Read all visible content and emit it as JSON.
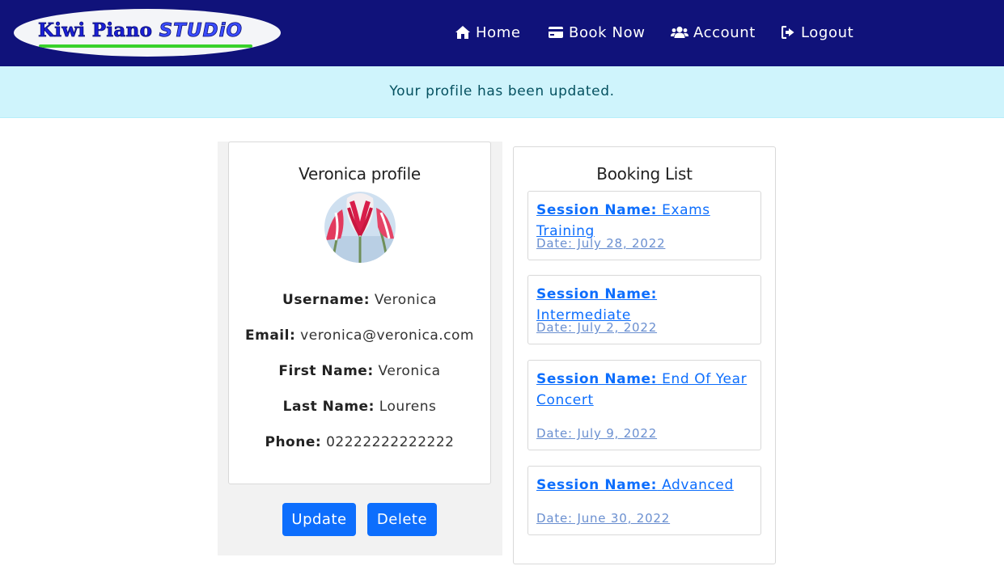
{
  "brand": {
    "logo_text": "Kiwi Piano",
    "logo_text_studio": "STUDiO"
  },
  "nav": {
    "home": "Home",
    "book_now": "Book Now",
    "account": "Account",
    "logout": "Logout"
  },
  "alert": {
    "message": "Your profile has been updated."
  },
  "profile": {
    "title": "Veronica profile",
    "fields": [
      {
        "label": "Username:",
        "value": "Veronica"
      },
      {
        "label": "Email:",
        "value": "veronica@veronica.com"
      },
      {
        "label": "First Name:",
        "value": "Veronica"
      },
      {
        "label": "Last Name:",
        "value": "Lourens"
      },
      {
        "label": "Phone:",
        "value": "02222222222222"
      }
    ],
    "update_label": "Update",
    "delete_label": "Delete"
  },
  "bookings": {
    "title": "Booking List",
    "items": [
      {
        "session_label": "Session Name:",
        "session_name": "Exams Training",
        "date": "Date: July 28, 2022"
      },
      {
        "session_label": "Session Name:",
        "session_name": "Intermediate",
        "date": "Date: July 2, 2022"
      },
      {
        "session_label": "Session Name:",
        "session_name": "End Of Year Concert",
        "date": "Date: July 9, 2022"
      },
      {
        "session_label": "Session Name:",
        "session_name": "Advanced",
        "date": "Date: June 30, 2022"
      }
    ]
  },
  "colors": {
    "navbar": "#10127a",
    "alert_bg": "#cff4fc",
    "alert_text": "#055160",
    "primary": "#0d6efd",
    "logo_green": "#39d12b"
  },
  "icons": {
    "home": "home-icon",
    "book_now": "credit-card-icon",
    "account": "users-icon",
    "logout": "sign-out-icon"
  }
}
